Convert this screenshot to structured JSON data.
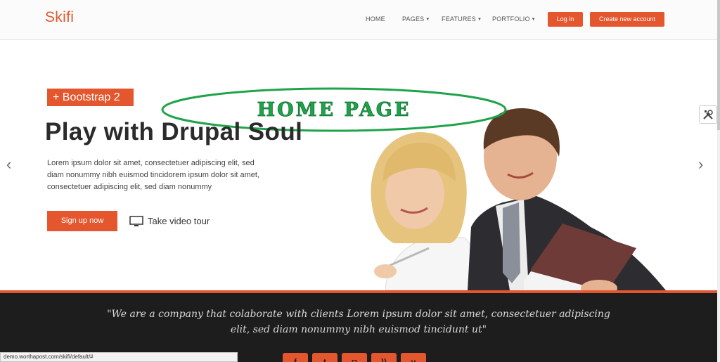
{
  "header": {
    "logo": "Skifi",
    "nav": [
      {
        "label": "HOME",
        "has_caret": false
      },
      {
        "label": "PAGES",
        "has_caret": true
      },
      {
        "label": "FEATURES",
        "has_caret": true
      },
      {
        "label": "PORTFOLIO",
        "has_caret": true
      }
    ],
    "login_label": "Log in",
    "create_account_label": "Create new account"
  },
  "hero": {
    "stamp_text": "HOME PAGE",
    "badge": "+ Bootstrap 2",
    "title": "Play with Drupal Soul",
    "body": "Lorem ipsum dolor sit amet, consectetuer adipiscing elit, sed diam nonummy nibh euismod tincidorem ipsum dolor sit amet, consectetuer adipiscing elit, sed diam nonummy",
    "signup_label": "Sign up now",
    "tour_label": "Take video tour",
    "prev_arrow": "‹",
    "next_arrow": "›"
  },
  "quote": {
    "text": "\"We are a company that colaborate with clients Lorem ipsum dolor sit amet, consectetuer adipiscing elit, sed diam nonummy nibh euismod tincidunt ut\""
  },
  "social_icons": [
    "facebook-icon",
    "twitter-icon",
    "instagram-icon",
    "rss-icon",
    "vimeo-icon"
  ],
  "status_bar": {
    "url": "demo.worthapost.com/skifi/default/#"
  },
  "colors": {
    "accent": "#e4572e",
    "stamp_green": "#1fa34a",
    "dark_band": "#1d1d1d"
  }
}
